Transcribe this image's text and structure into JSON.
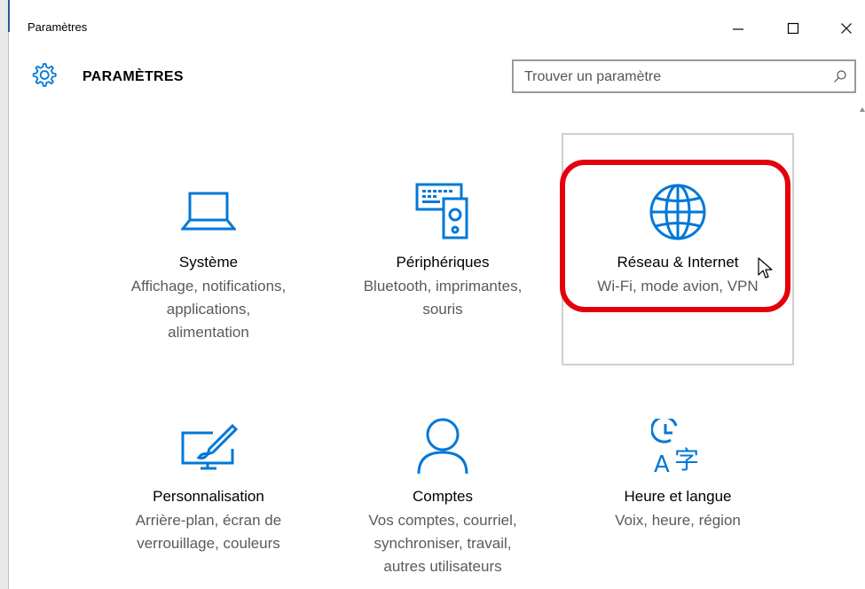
{
  "window": {
    "title": "Paramètres",
    "minimize_icon": "minimize-icon",
    "maximize_icon": "maximize-icon",
    "close_icon": "close-icon"
  },
  "header": {
    "icon": "gear-icon",
    "title": "PARAMÈTRES",
    "search_placeholder": "Trouver un paramètre",
    "search_value": "",
    "search_icon": "search-icon"
  },
  "accent_color": "#0078d7",
  "highlight_color": "#e3000b",
  "tiles": [
    {
      "icon": "laptop-icon",
      "title": "Système",
      "description": [
        "Affichage, notifications,",
        "applications,",
        "alimentation"
      ]
    },
    {
      "icon": "keyboard-speaker-icon",
      "title": "Périphériques",
      "description": [
        "Bluetooth, imprimantes,",
        "souris"
      ]
    },
    {
      "icon": "globe-icon",
      "title": "Réseau & Internet",
      "description": [
        "Wi-Fi, mode avion, VPN"
      ],
      "state": "hovered"
    },
    {
      "icon": "paint-display-icon",
      "title": "Personnalisation",
      "description": [
        "Arrière-plan, écran de",
        "verrouillage, couleurs"
      ]
    },
    {
      "icon": "person-icon",
      "title": "Comptes",
      "description": [
        "Vos comptes, courriel,",
        "synchroniser, travail,",
        "autres utilisateurs"
      ]
    },
    {
      "icon": "clock-language-icon",
      "title": "Heure et langue",
      "description": [
        "Voix, heure, région"
      ]
    }
  ]
}
